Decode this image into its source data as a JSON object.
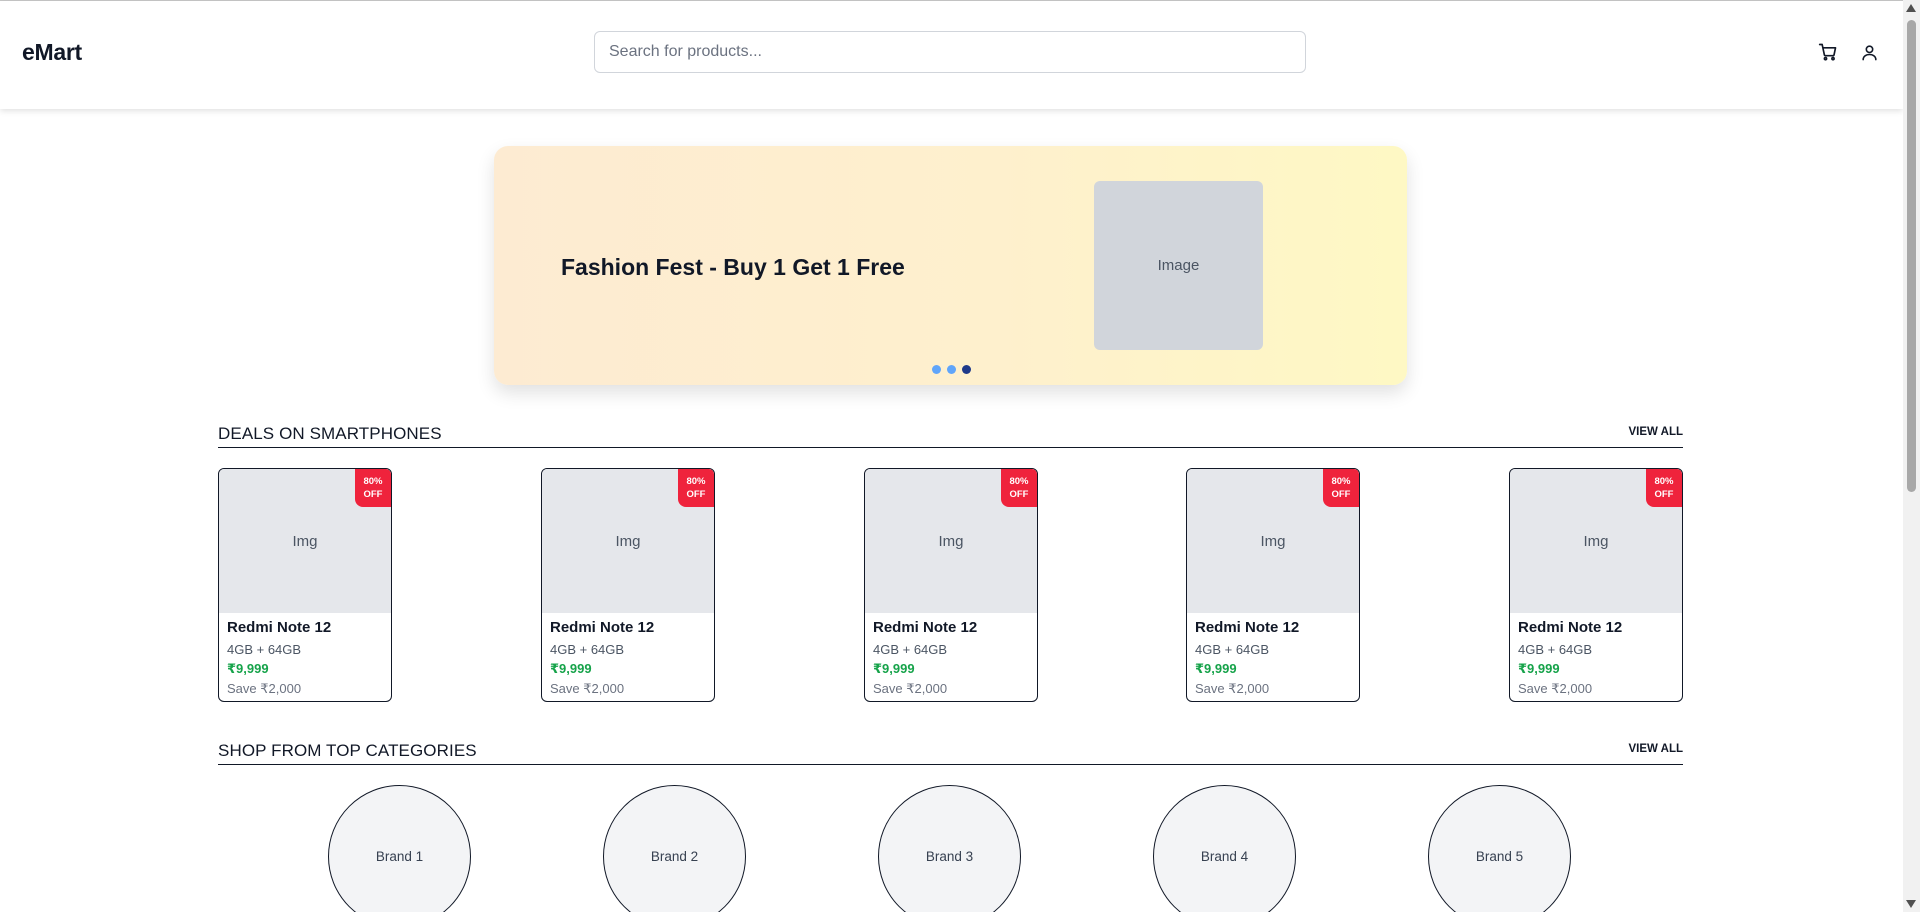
{
  "header": {
    "logo": "eMart",
    "search_placeholder": "Search for products...",
    "cart_icon": "cart-icon",
    "user_icon": "user-icon"
  },
  "banner": {
    "title": "Fashion Fest - Buy 1 Get 1 Free",
    "image_label": "Image",
    "dots_count": 3,
    "active_dot": 3,
    "colors": {
      "gradient_start": "#fdebd2",
      "gradient_end": "#fef8c4",
      "dot": "#60a5fa",
      "dot_active": "#1e3a8a"
    }
  },
  "deals": {
    "title": "DEALS ON SMARTPHONES",
    "view_all": "VIEW ALL",
    "products": [
      {
        "image_label": "Img",
        "badge": "80%\nOFF",
        "name": "Redmi Note 12",
        "spec": "4GB + 64GB",
        "price": "₹9,999",
        "save": "Save ₹2,000"
      },
      {
        "image_label": "Img",
        "badge": "80%\nOFF",
        "name": "Redmi Note 12",
        "spec": "4GB + 64GB",
        "price": "₹9,999",
        "save": "Save ₹2,000"
      },
      {
        "image_label": "Img",
        "badge": "80%\nOFF",
        "name": "Redmi Note 12",
        "spec": "4GB + 64GB",
        "price": "₹9,999",
        "save": "Save ₹2,000"
      },
      {
        "image_label": "Img",
        "badge": "80%\nOFF",
        "name": "Redmi Note 12",
        "spec": "4GB + 64GB",
        "price": "₹9,999",
        "save": "Save ₹2,000"
      },
      {
        "image_label": "Img",
        "badge": "80%\nOFF",
        "name": "Redmi Note 12",
        "spec": "4GB + 64GB",
        "price": "₹9,999",
        "save": "Save ₹2,000"
      }
    ],
    "colors": {
      "badge": "#ef233c",
      "price": "#16a34a"
    }
  },
  "categories": {
    "title": "SHOP FROM TOP CATEGORIES",
    "view_all": "VIEW ALL",
    "brands": [
      "Brand 1",
      "Brand 2",
      "Brand 3",
      "Brand 4",
      "Brand 5"
    ]
  }
}
